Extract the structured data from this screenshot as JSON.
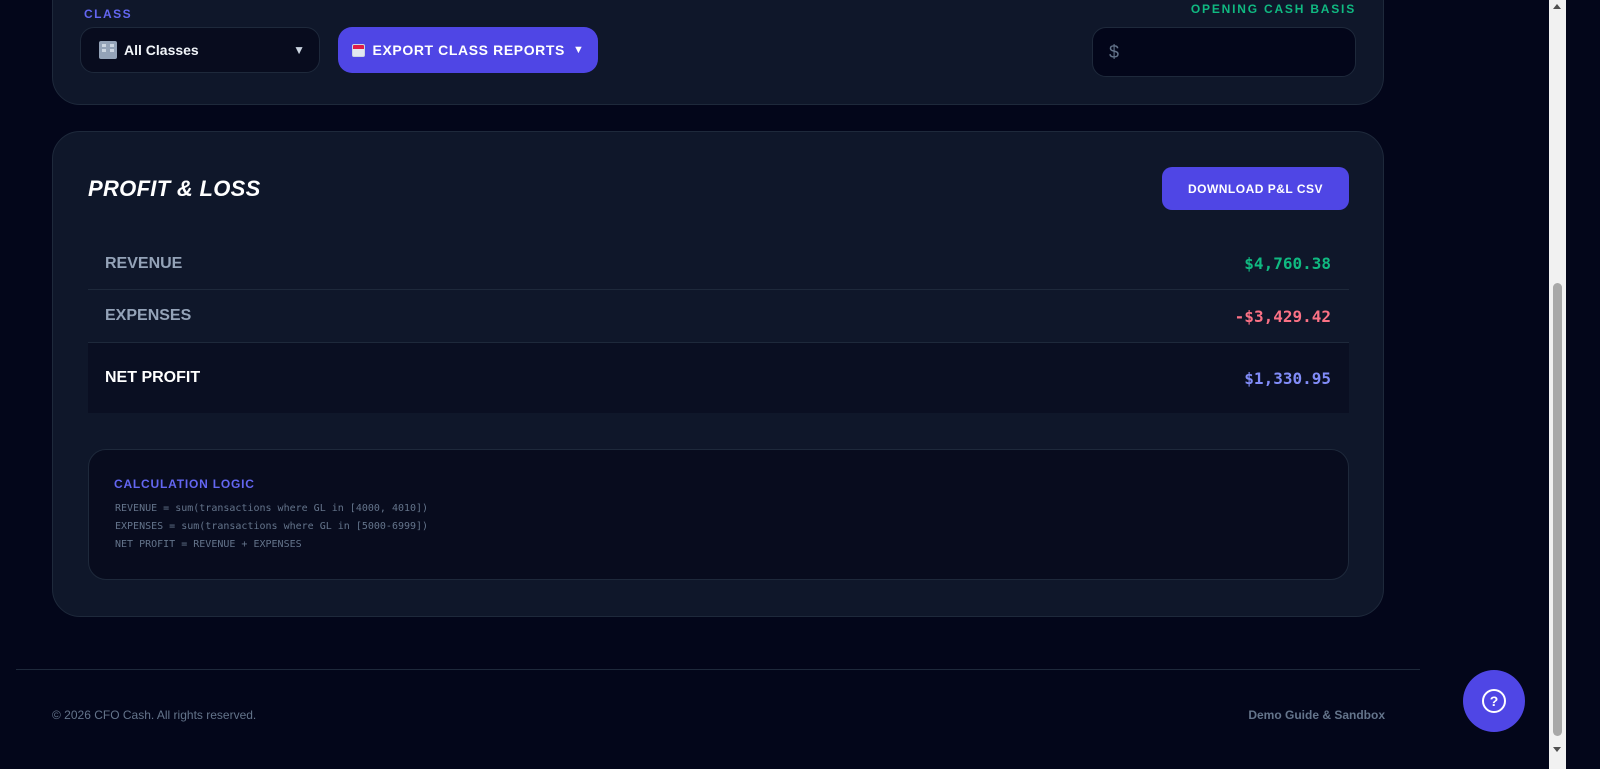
{
  "filters": {
    "class_label": "CLASS",
    "class_select_value": "All Classes",
    "export_label": "EXPORT CLASS REPORTS",
    "opening_cash_label": "OPENING CASH BASIS",
    "opening_cash_prefix": "$",
    "opening_cash_value": ""
  },
  "pl": {
    "title": "PROFIT & LOSS",
    "download_label": "DOWNLOAD P&L CSV",
    "rows": [
      {
        "label": "REVENUE",
        "value": "$4,760.38"
      },
      {
        "label": "EXPENSES",
        "value": "-$3,429.42"
      },
      {
        "label": "NET PROFIT",
        "value": "$1,330.95"
      }
    ],
    "logic": {
      "title": "CALCULATION LOGIC",
      "lines": [
        "REVENUE = sum(transactions where GL in [4000, 4010])",
        "EXPENSES = sum(transactions where GL in [5000-6999])",
        "NET PROFIT = REVENUE + EXPENSES"
      ]
    }
  },
  "footer": {
    "copyright": "© 2026 CFO Cash. All rights reserved.",
    "demo_link": "Demo Guide & Sandbox"
  },
  "icons": {
    "class_select": "building-icon",
    "export": "report-icon",
    "help": "question-circle-icon"
  },
  "colors": {
    "accent": "#4f46e5",
    "positive": "#10b981",
    "negative": "#fb7185",
    "net": "#818cf8"
  }
}
